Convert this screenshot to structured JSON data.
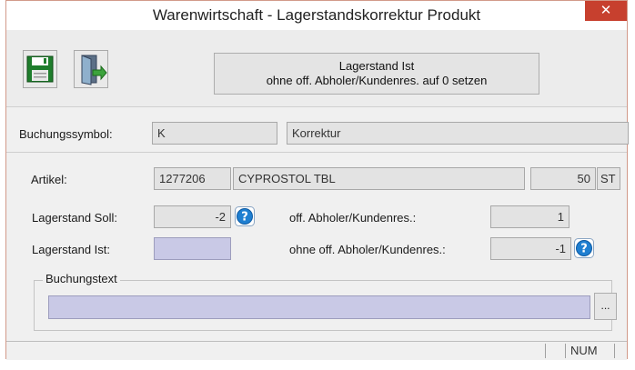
{
  "window": {
    "title": "Warenwirtschaft - Lagerstandskorrektur Produkt",
    "close_glyph": "✕"
  },
  "toolbar": {
    "save_icon": "floppy-disk-icon",
    "exit_icon": "exit-door-icon",
    "reset_button": {
      "line1": "Lagerstand Ist",
      "line2": "ohne off. Abholer/Kundenres. auf 0 setzen"
    }
  },
  "booking": {
    "label": "Buchungssymbol:",
    "code": "K",
    "description": "Korrektur"
  },
  "article": {
    "label": "Artikel:",
    "number": "1277206",
    "name": "CYPROSTOL TBL",
    "quantity": "50",
    "unit": "ST"
  },
  "stock": {
    "soll_label": "Lagerstand Soll:",
    "soll_value": "-2",
    "ist_label": "Lagerstand Ist:",
    "ist_value": "",
    "open_label": "off. Abholer/Kundenres.:",
    "open_value": "1",
    "without_label": "ohne off. Abholer/Kundenres.:",
    "without_value": "-1"
  },
  "buchungstext": {
    "legend": "Buchungstext",
    "value": "",
    "browse_label": "..."
  },
  "statusbar": {
    "num": "NUM"
  },
  "colors": {
    "editable_field": "#c9c9e6",
    "close_button": "#c7402e",
    "help_icon": "#1f7fd1"
  }
}
